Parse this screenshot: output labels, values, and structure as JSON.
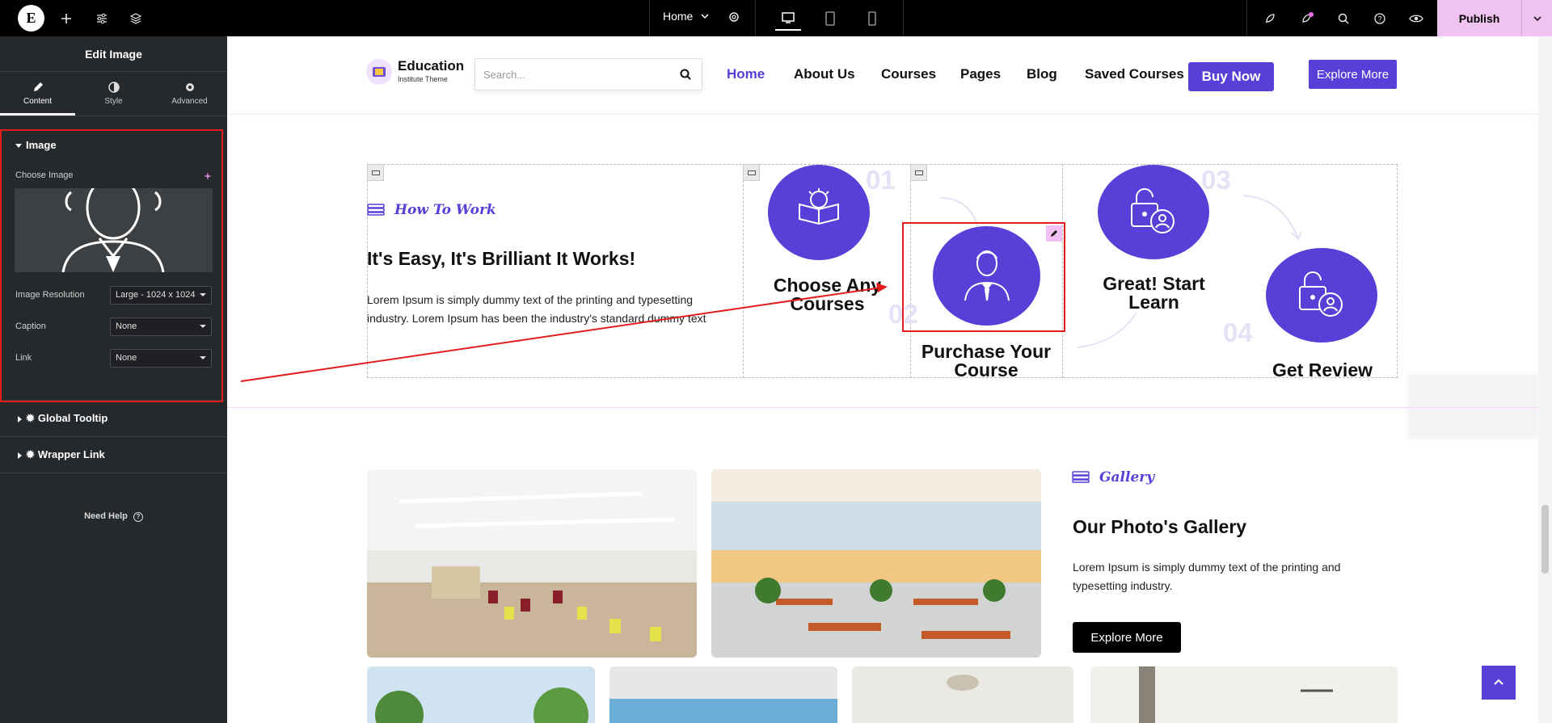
{
  "topbar": {
    "logo": "E",
    "page_label": "Home",
    "publish_label": "Publish",
    "icons": [
      "plus-icon",
      "sliders-icon",
      "layers-icon",
      "gear-icon",
      "desktop-icon",
      "tablet-icon",
      "mobile-icon",
      "rocket-icon",
      "notifications-icon",
      "search-icon",
      "help-icon",
      "eye-icon"
    ]
  },
  "panel": {
    "title": "Edit Image",
    "tabs": [
      {
        "label": "Content",
        "icon": "pencil-icon"
      },
      {
        "label": "Style",
        "icon": "half-circle-icon"
      },
      {
        "label": "Advanced",
        "icon": "gear-icon"
      }
    ],
    "section": "Image",
    "choose_image_label": "Choose Image",
    "controls": [
      {
        "label": "Image Resolution",
        "value": "Large - 1024 x 1024"
      },
      {
        "label": "Caption",
        "value": "None"
      },
      {
        "label": "Link",
        "value": "None"
      }
    ],
    "accordions": [
      "Global Tooltip",
      "Wrapper Link"
    ],
    "need_help": "Need Help"
  },
  "site": {
    "logo_name": "Education",
    "logo_sub": "Institute Theme",
    "search_placeholder": "Search...",
    "nav": [
      "Home",
      "About Us",
      "Courses",
      "Pages",
      "Blog",
      "Saved Courses"
    ],
    "buy_now": "Buy Now",
    "explore_more": "Explore More",
    "how": {
      "kicker": "How To Work",
      "heading": "It's Easy, It's Brilliant It Works!",
      "body": "Lorem Ipsum is simply dummy text of the printing and typesetting industry. Lorem Ipsum has been the industry's standard dummy text"
    },
    "steps": [
      {
        "num": "01",
        "title": "Choose Any Courses"
      },
      {
        "num": "02",
        "title": "Purchase Your Course"
      },
      {
        "num": "03",
        "title": "Great! Start Learn"
      },
      {
        "num": "04",
        "title": "Get Review"
      }
    ],
    "gallery": {
      "kicker": "Gallery",
      "heading": "Our Photo's Gallery",
      "body": "Lorem Ipsum is simply dummy text of the printing and typesetting industry.",
      "button": "Explore More"
    },
    "accent_color": "#5740d8"
  }
}
